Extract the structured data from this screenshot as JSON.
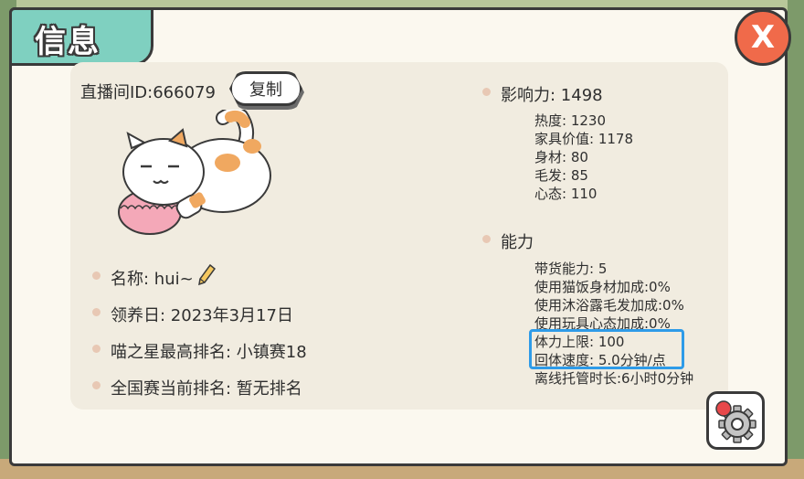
{
  "title": "信息",
  "close_label": "X",
  "left": {
    "stream_id": "直播间ID:666079",
    "copy_label": "复制",
    "name_line": "名称: hui~",
    "adopt_date": "领养日: 2023年3月17日",
    "star_rank": "喵之星最高排名: 小镇赛18",
    "national_rank": "全国赛当前排名: 暂无排名"
  },
  "influence": {
    "heading": "影响力: 1498",
    "stats": [
      "热度: 1230",
      "家具价值: 1178",
      "身材: 80",
      "毛发: 85",
      "心态: 110"
    ]
  },
  "ability": {
    "heading": "能力",
    "stats": [
      "带货能力: 5",
      "使用猫饭身材加成:0%",
      "使用沐浴露毛发加成:0%",
      "使用玩具心态加成:0%",
      "体力上限: 100",
      "回体速度: 5.0分钟/点",
      "离线托管时长:6小时0分钟"
    ]
  },
  "colors": {
    "title_tab": "#7fd0c0",
    "close_button": "#f06a4a",
    "highlight": "#2e9be8",
    "panel": "#f1ece0",
    "bullet": "#e8c8b4"
  },
  "icons": {
    "close": "close-icon",
    "edit": "pencil-icon",
    "settings": "gear-icon",
    "pet": "cat-illustration"
  }
}
